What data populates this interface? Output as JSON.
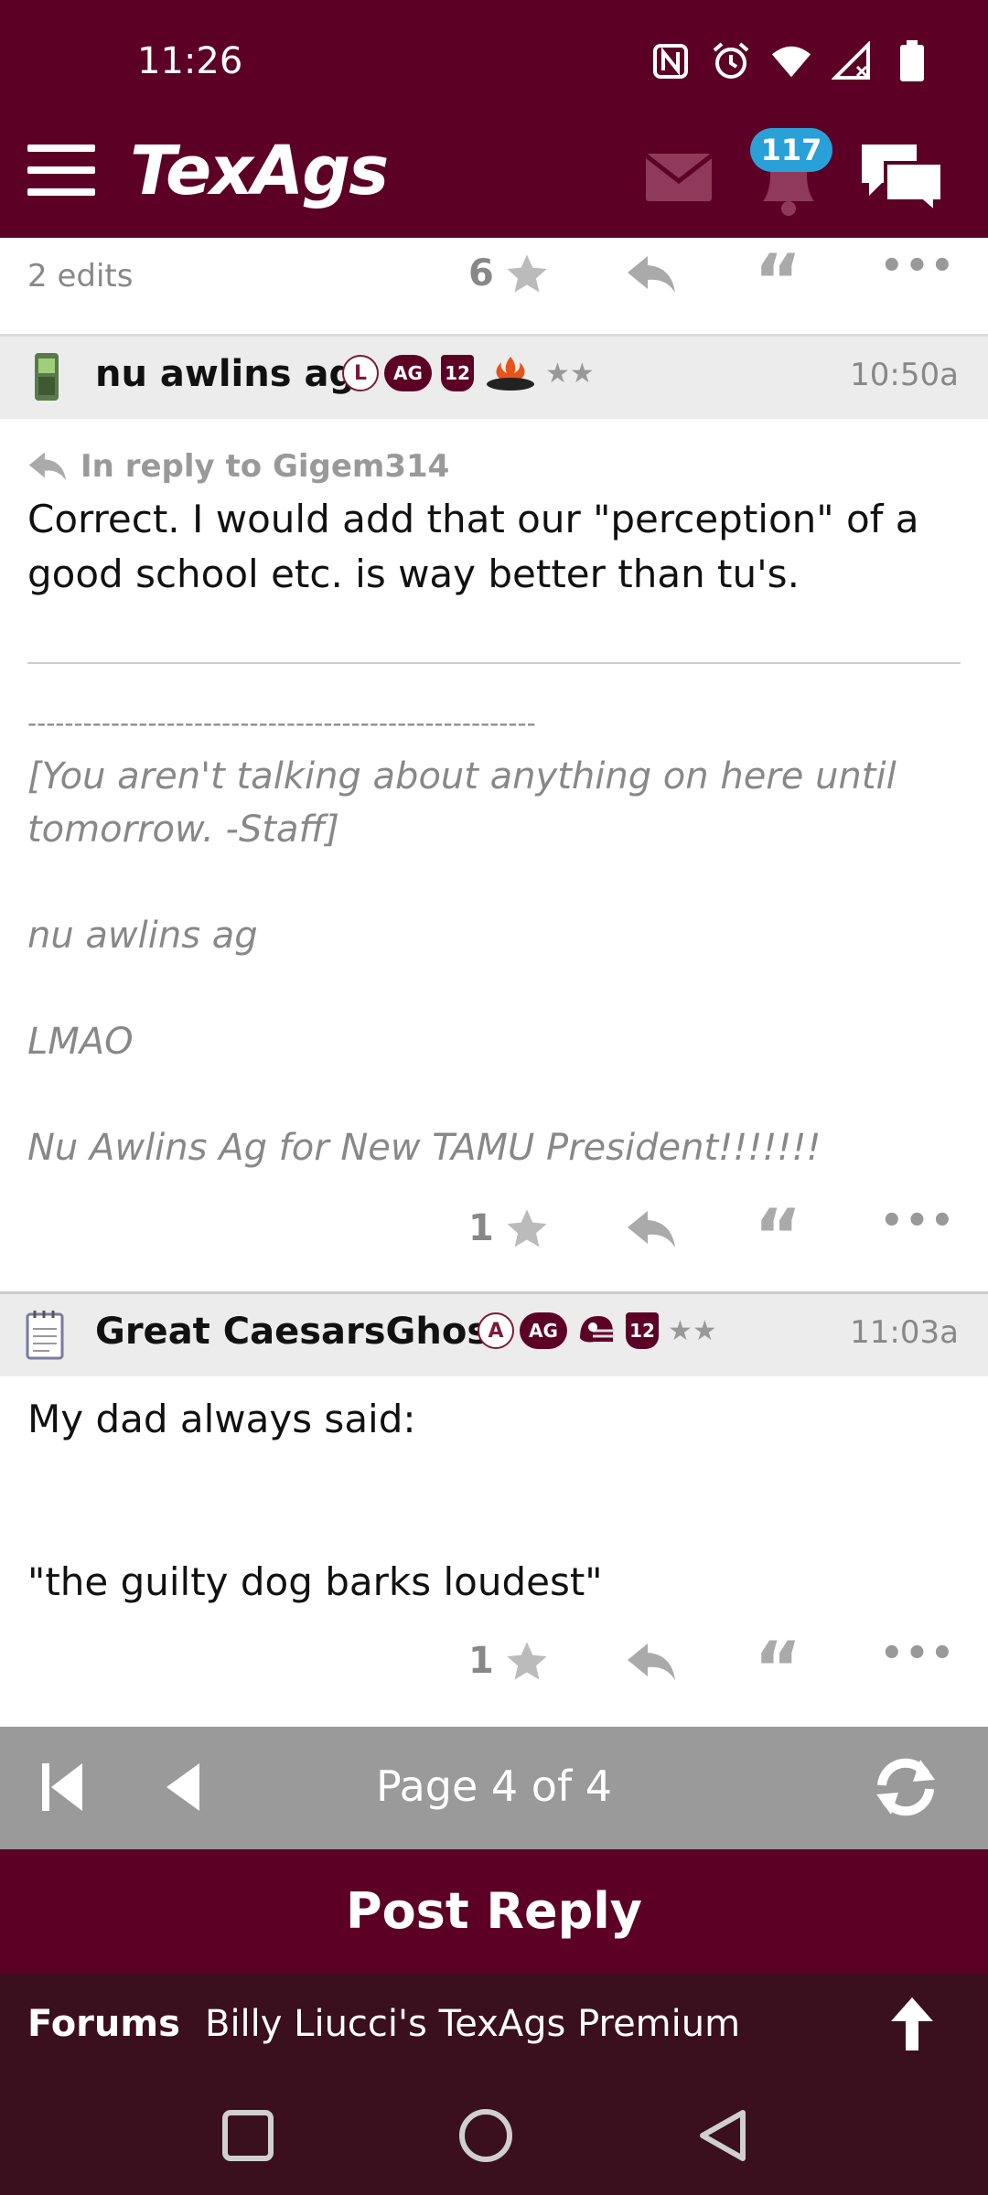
{
  "status": {
    "time": "11:26"
  },
  "header": {
    "logo": "TexAgs",
    "notification_count": "117"
  },
  "post0": {
    "edits": "2 edits",
    "likes": "6"
  },
  "post1": {
    "username": "nu awlins ag",
    "badges": [
      "L",
      "AG",
      "12"
    ],
    "time": "10:50a",
    "reply_to": "In reply to Gigem314",
    "body": "Correct. I would add that our \"perception\" of a good school etc. is way better than tu's.",
    "signature": {
      "rule": "-------------------------------------------------------",
      "line1": "[You aren't talking about anything on here until tomorrow. -Staff]",
      "line2": "nu awlins ag",
      "line3": "LMAO",
      "line4": "Nu Awlins Ag for New TAMU President!!!!!!!"
    },
    "likes": "1"
  },
  "post2": {
    "username": "Great CaesarsGhost",
    "badges": [
      "A",
      "AG",
      "12"
    ],
    "time": "11:03a",
    "body_line1": "My dad always said:",
    "body_line2": "\"the guilty dog barks loudest\"",
    "likes": "1"
  },
  "pager": {
    "label": "Page 4 of 4"
  },
  "actions": {
    "post_reply": "Post Reply"
  },
  "footer": {
    "forums_label": "Forums",
    "breadcrumb": "Billy Liucci's TexAgs Premium"
  },
  "colors": {
    "maroon": "#5d0026",
    "badge_blue": "#2aa0d8",
    "pager_gray": "#9a9a9a"
  }
}
